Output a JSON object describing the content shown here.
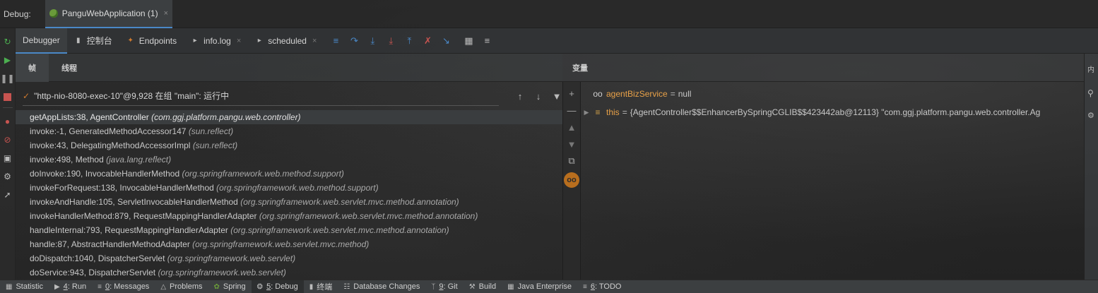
{
  "title_bar": {
    "label": "Debug:",
    "run_tab": "PanguWebApplication (1)",
    "close": "×"
  },
  "toolbar": {
    "tabs": [
      {
        "label": "Debugger",
        "icon": "debugger-icon"
      },
      {
        "label": "控制台",
        "icon": "console-icon"
      },
      {
        "label": "Endpoints",
        "icon": "endpoints-icon"
      },
      {
        "label": "info.log",
        "icon": "log-icon"
      },
      {
        "label": "scheduled",
        "icon": "log-icon"
      }
    ]
  },
  "frames_panel": {
    "tabs": [
      "帧",
      "线程"
    ],
    "thread": "\"http-nio-8080-exec-10\"@9,928 在组 \"main\": 运行中",
    "frames": [
      {
        "method": "getAppLists:38, AgentController",
        "pkg": "(com.ggj.platform.pangu.web.controller)"
      },
      {
        "method": "invoke:-1, GeneratedMethodAccessor147",
        "pkg": "(sun.reflect)"
      },
      {
        "method": "invoke:43, DelegatingMethodAccessorImpl",
        "pkg": "(sun.reflect)"
      },
      {
        "method": "invoke:498, Method",
        "pkg": "(java.lang.reflect)"
      },
      {
        "method": "doInvoke:190, InvocableHandlerMethod",
        "pkg": "(org.springframework.web.method.support)"
      },
      {
        "method": "invokeForRequest:138, InvocableHandlerMethod",
        "pkg": "(org.springframework.web.method.support)"
      },
      {
        "method": "invokeAndHandle:105, ServletInvocableHandlerMethod",
        "pkg": "(org.springframework.web.servlet.mvc.method.annotation)"
      },
      {
        "method": "invokeHandlerMethod:879, RequestMappingHandlerAdapter",
        "pkg": "(org.springframework.web.servlet.mvc.method.annotation)"
      },
      {
        "method": "handleInternal:793, RequestMappingHandlerAdapter",
        "pkg": "(org.springframework.web.servlet.mvc.method.annotation)"
      },
      {
        "method": "handle:87, AbstractHandlerMethodAdapter",
        "pkg": "(org.springframework.web.servlet.mvc.method)"
      },
      {
        "method": "doDispatch:1040, DispatcherServlet",
        "pkg": "(org.springframework.web.servlet)"
      },
      {
        "method": "doService:943, DispatcherServlet",
        "pkg": "(org.springframework.web.servlet)"
      }
    ]
  },
  "variables_panel": {
    "label": "变量",
    "vars": [
      {
        "name": "agentBizService",
        "eq": "=",
        "value": "null",
        "icon": "watch-glasses-icon"
      },
      {
        "name": "this",
        "eq": "=",
        "value": "{AgentController$$EnhancerBySpringCGLIB$$423442ab@12113} \"com.ggj.platform.pangu.web.controller.Ag",
        "icon": "field-icon"
      }
    ]
  },
  "right_panel": {
    "label": "内"
  },
  "bottom_bar": {
    "items": [
      {
        "num": "",
        "label": "Statistic",
        "icon": "statistic-icon"
      },
      {
        "num": "4",
        "label": ": Run",
        "icon": "run-icon"
      },
      {
        "num": "0",
        "label": ": Messages",
        "icon": "messages-icon"
      },
      {
        "num": "",
        "label": "Problems",
        "icon": "problems-icon"
      },
      {
        "num": "",
        "label": "Spring",
        "icon": "spring-icon"
      },
      {
        "num": "5",
        "label": ": Debug",
        "icon": "debug-icon"
      },
      {
        "num": "",
        "label": "终端",
        "icon": "terminal-icon"
      },
      {
        "num": "",
        "label": "Database Changes",
        "icon": "database-icon"
      },
      {
        "num": "9",
        "label": ": Git",
        "icon": "git-icon"
      },
      {
        "num": "",
        "label": "Build",
        "icon": "build-icon"
      },
      {
        "num": "",
        "label": "Java Enterprise",
        "icon": "java-enterprise-icon"
      },
      {
        "num": "6",
        "label": ": TODO",
        "icon": "todo-icon"
      }
    ]
  },
  "colors": {
    "accent": "#4a88c7",
    "variable_name": "#e8a148",
    "check": "#d07a2e",
    "run_green": "#4caf50",
    "stop_red": "#c75450"
  }
}
